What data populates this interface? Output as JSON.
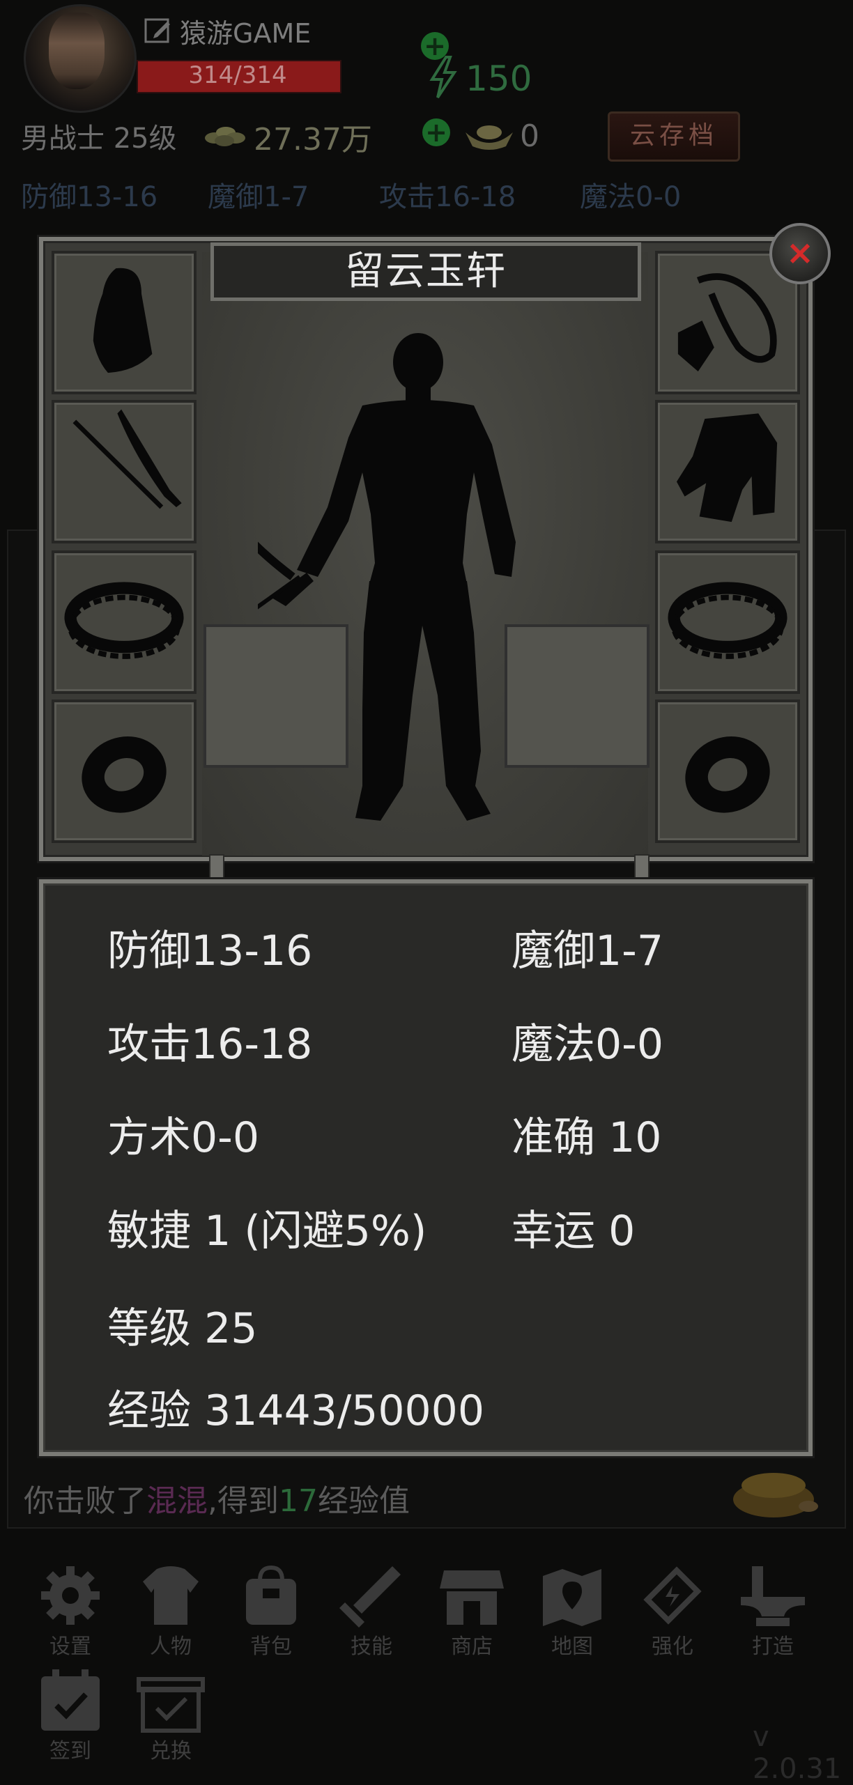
{
  "header": {
    "player_name": "猿游GAME",
    "hp_text": "314/314",
    "hp_fraction": 1.0,
    "energy_value": "150",
    "class_level": "男战士 25级",
    "gold_value": "27.37万",
    "ingot_value": "0",
    "cloud_save_label": "云存档"
  },
  "top_stats": [
    "防御13-16",
    "魔御1-7",
    "攻击16-18",
    "魔法0-0"
  ],
  "equipment": {
    "title": "留云玉轩",
    "left_slots": [
      "helmet-icon",
      "sword-icon",
      "bracelet-icon",
      "ring-icon"
    ],
    "right_slots": [
      "necklace-icon",
      "armor-icon",
      "bracelet-icon",
      "ring-icon"
    ]
  },
  "stats": {
    "defense": "防御13-16",
    "magic_defense": "魔御1-7",
    "attack": "攻击16-18",
    "magic": "魔法0-0",
    "taoism": "方术0-0",
    "accuracy": "准确 10",
    "agility": "敏捷 1 (闪避5%)",
    "luck": "幸运 0",
    "level": "等级 25",
    "experience": "经验 31443/50000"
  },
  "battle_log": {
    "prefix": "你击败了",
    "enemy": "混混",
    "middle": ",得到",
    "exp": "17",
    "suffix": "经验值"
  },
  "nav": {
    "items": [
      {
        "label": "设置",
        "icon": "gear-icon"
      },
      {
        "label": "人物",
        "icon": "character-icon"
      },
      {
        "label": "背包",
        "icon": "bag-icon"
      },
      {
        "label": "技能",
        "icon": "skill-icon"
      },
      {
        "label": "商店",
        "icon": "shop-icon"
      },
      {
        "label": "地图",
        "icon": "map-icon"
      },
      {
        "label": "强化",
        "icon": "enhance-icon"
      },
      {
        "label": "打造",
        "icon": "forge-icon"
      }
    ],
    "items2": [
      {
        "label": "签到",
        "icon": "checkin-icon"
      },
      {
        "label": "兑换",
        "icon": "exchange-icon"
      }
    ]
  },
  "version": "v 2.0.31",
  "colors": {
    "panel_border": "#7b7b76",
    "stat_text": "#ececec",
    "close_x": "#d42a2a",
    "hp_fill": "#8a1a1a"
  }
}
